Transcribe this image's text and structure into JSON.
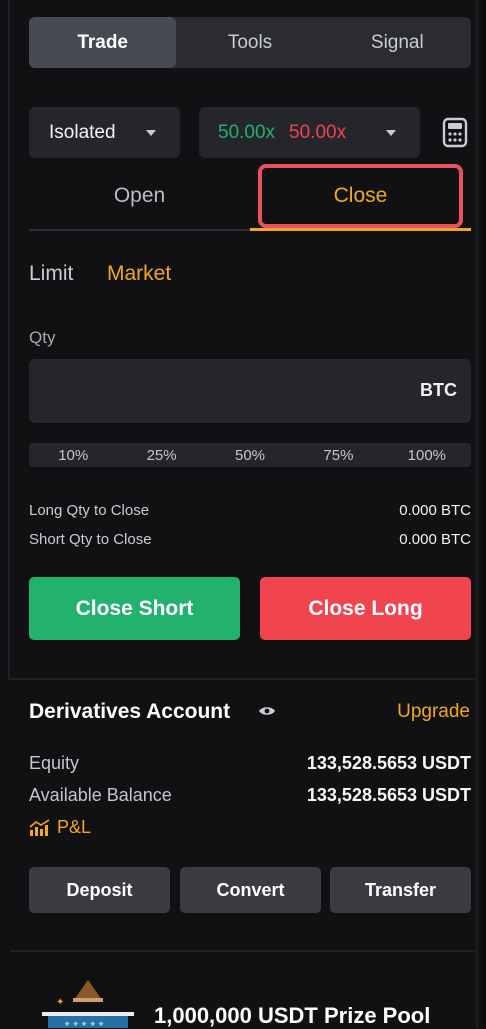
{
  "tabs": [
    {
      "label": "Trade",
      "active": true
    },
    {
      "label": "Tools",
      "active": false
    },
    {
      "label": "Signal",
      "active": false
    }
  ],
  "margin_mode": {
    "value": "Isolated",
    "icon": "chevron-down-icon"
  },
  "leverage": {
    "long": "50.00x",
    "short": "50.00x",
    "long_color": "#23b26d",
    "short_color": "#f0444f",
    "icon": "chevron-down-icon"
  },
  "calculator_icon": "calculator-icon",
  "position_tabs": {
    "open": "Open",
    "close": "Close",
    "active": "Close",
    "accent": "#f0a91f"
  },
  "order_types": {
    "limit": "Limit",
    "market": "Market",
    "active": "Market"
  },
  "qty": {
    "label": "Qty",
    "value": "",
    "unit": "BTC"
  },
  "percent_options": [
    "10%",
    "25%",
    "50%",
    "75%",
    "100%"
  ],
  "close_info": {
    "long_label": "Long Qty to Close",
    "long_value": "0.000 BTC",
    "short_label": "Short Qty to Close",
    "short_value": "0.000 BTC"
  },
  "actions": {
    "close_short": "Close Short",
    "close_long": "Close Long",
    "short_color": "#23b26d",
    "long_color": "#f0444f"
  },
  "account": {
    "title": "Derivatives Account",
    "upgrade": "Upgrade",
    "equity_label": "Equity",
    "equity_value": "133,528.5653 USDT",
    "available_label": "Available Balance",
    "available_value": "133,528.5653 USDT",
    "pnl_label": "P&L",
    "buttons": [
      "Deposit",
      "Convert",
      "Transfer"
    ]
  },
  "promo": {
    "title": "1,000,000 USDT Prize Pool"
  }
}
